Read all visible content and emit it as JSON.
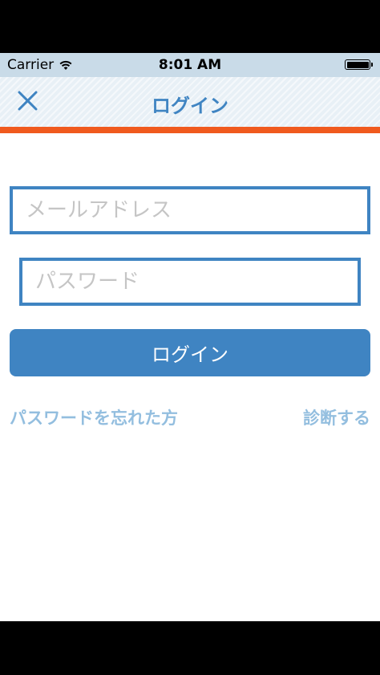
{
  "status_bar": {
    "carrier": "Carrier",
    "time": "8:01 AM"
  },
  "nav": {
    "title": "ログイン",
    "close_icon": "close-icon",
    "accent_color": "#f05a1e"
  },
  "form": {
    "email": {
      "value": "",
      "placeholder": "メールアドレス"
    },
    "password": {
      "value": "",
      "placeholder": "パスワード"
    },
    "login_label": "ログイン"
  },
  "links": {
    "forgot_password": "パスワードを忘れた方",
    "diagnose": "診断する"
  },
  "colors": {
    "primary": "#3f84c2",
    "link": "#93bedf"
  }
}
